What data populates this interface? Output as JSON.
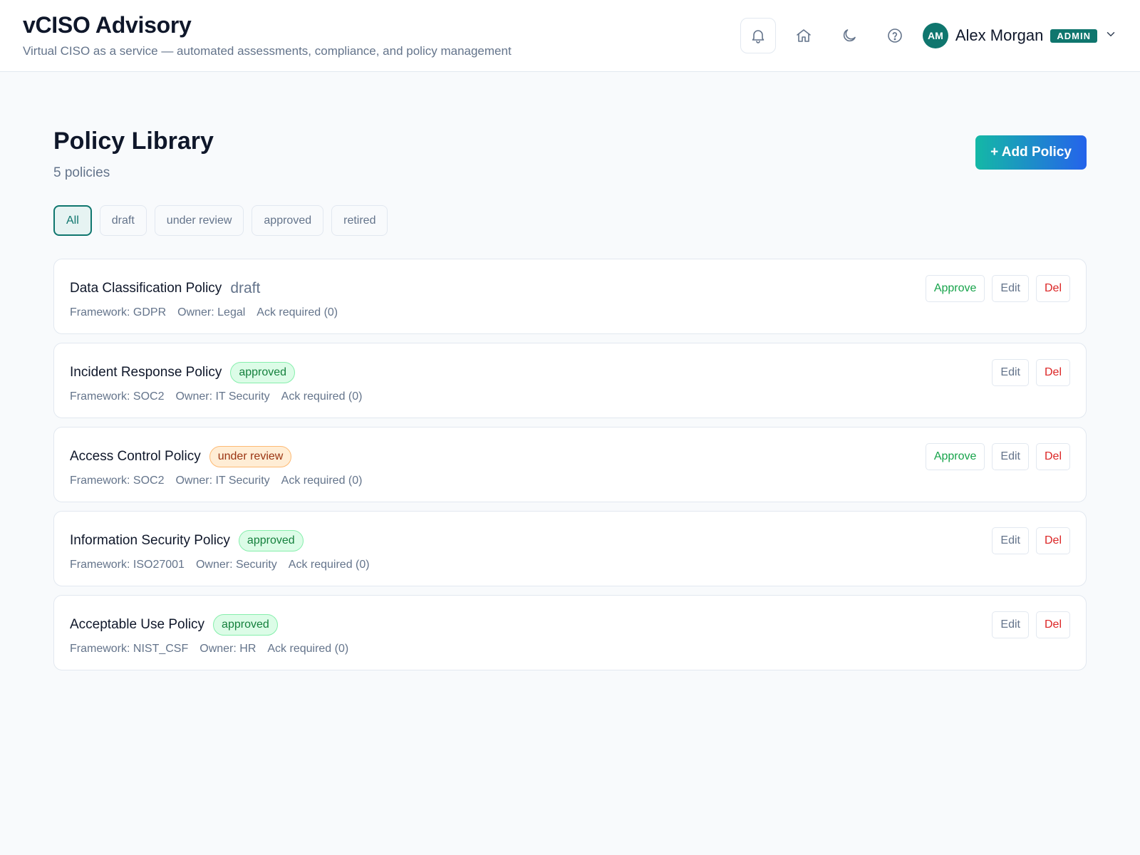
{
  "header": {
    "title": "vCISO Advisory",
    "subtitle": "Virtual CISO as a service — automated assessments, compliance, and policy management",
    "user": {
      "initials": "AM",
      "name": "Alex Morgan",
      "role": "ADMIN"
    },
    "icons": [
      "bell-icon",
      "home-icon",
      "moon-icon",
      "help-icon",
      "chevron-down-icon"
    ]
  },
  "page": {
    "title": "Policy Library",
    "count": "5 policies",
    "add_button": "+ Add Policy"
  },
  "filters": [
    "All",
    "draft",
    "under review",
    "approved",
    "retired"
  ],
  "actions": {
    "approve": "Approve",
    "edit": "Edit",
    "delete": "Del"
  },
  "policies": [
    {
      "title": "Data Classification Policy",
      "status": "draft",
      "framework": "Framework: GDPR",
      "owner": "Owner: Legal",
      "ack": "Ack required (0)"
    },
    {
      "title": "Incident Response Policy",
      "status": "approved",
      "framework": "Framework: SOC2",
      "owner": "Owner: IT Security",
      "ack": "Ack required (0)"
    },
    {
      "title": "Access Control Policy",
      "status": "under review",
      "framework": "Framework: SOC2",
      "owner": "Owner: IT Security",
      "ack": "Ack required (0)"
    },
    {
      "title": "Information Security Policy",
      "status": "approved",
      "framework": "Framework: ISO27001",
      "owner": "Owner: Security",
      "ack": "Ack required (0)"
    },
    {
      "title": "Acceptable Use Policy",
      "status": "approved",
      "framework": "Framework: NIST_CSF",
      "owner": "Owner: HR",
      "ack": "Ack required (0)"
    }
  ],
  "colors": {
    "accent": "#0f766e",
    "approved": "#15803d",
    "review": "#9a3412",
    "danger": "#dc2626",
    "gradient_start": "#14b8a6",
    "gradient_end": "#2563eb"
  }
}
